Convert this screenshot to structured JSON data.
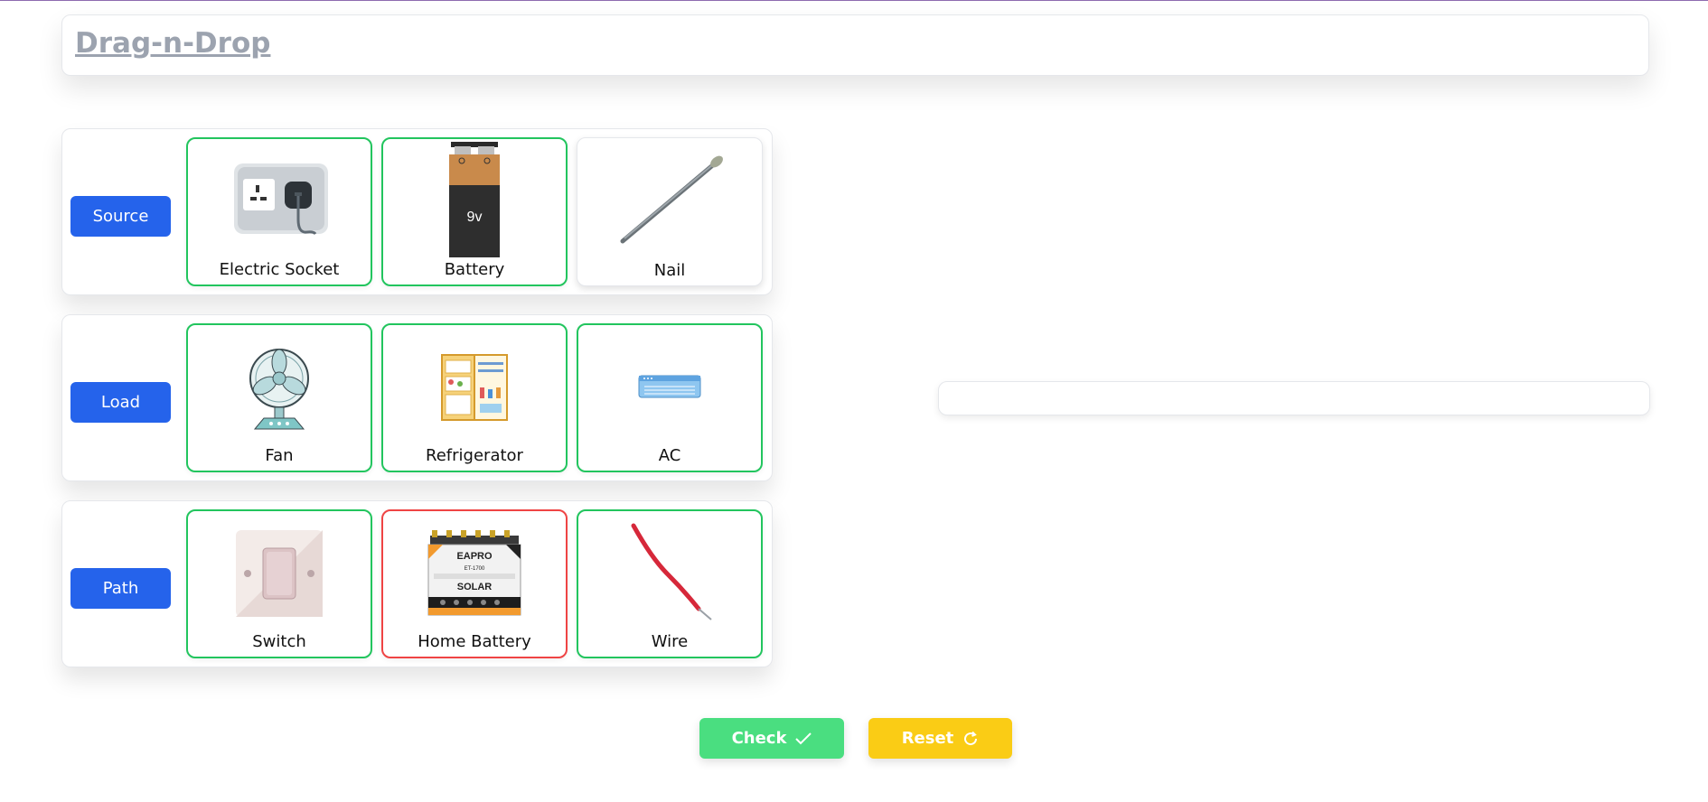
{
  "header": {
    "title": "Drag-n-Drop"
  },
  "rows": [
    {
      "label": "Source",
      "cards": [
        {
          "caption": "Electric Socket",
          "icon": "electric-socket-icon",
          "state": "correct"
        },
        {
          "caption": "Battery",
          "icon": "battery-9v-icon",
          "state": "correct",
          "battery_text": "9v"
        },
        {
          "caption": "Nail",
          "icon": "nail-icon",
          "state": "none"
        }
      ]
    },
    {
      "label": "Load",
      "cards": [
        {
          "caption": "Fan",
          "icon": "fan-icon",
          "state": "correct"
        },
        {
          "caption": "Refrigerator",
          "icon": "refrigerator-icon",
          "state": "correct"
        },
        {
          "caption": "AC",
          "icon": "air-conditioner-icon",
          "state": "correct"
        }
      ]
    },
    {
      "label": "Path",
      "cards": [
        {
          "caption": "Switch",
          "icon": "switch-icon",
          "state": "correct"
        },
        {
          "caption": "Home Battery",
          "icon": "home-battery-icon",
          "state": "incorrect",
          "brand": "EAPRO",
          "model": "ET-1700",
          "product": "SOLAR"
        },
        {
          "caption": "Wire",
          "icon": "wire-icon",
          "state": "correct"
        }
      ]
    }
  ],
  "buttons": {
    "check_label": "Check",
    "reset_label": "Reset"
  },
  "colors": {
    "primary": "#2563eb",
    "correct": "#22c55e",
    "incorrect": "#ef4444",
    "check": "#4ade80",
    "reset": "#facc15"
  }
}
